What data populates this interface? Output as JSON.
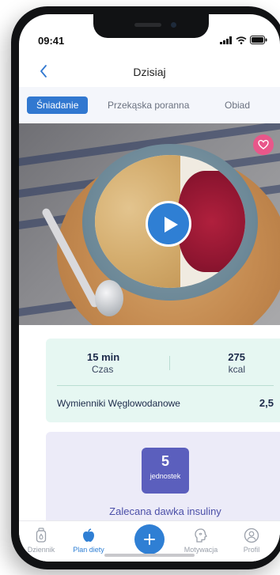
{
  "status": {
    "time": "09:41"
  },
  "nav": {
    "title": "Dzisiaj"
  },
  "tabs": [
    {
      "label": "Śniadanie"
    },
    {
      "label": "Przekąska poranna"
    },
    {
      "label": "Obiad"
    }
  ],
  "info": {
    "time_value": "15 min",
    "time_label": "Czas",
    "kcal_value": "275",
    "kcal_label": "kcal",
    "exchange_label": "Wymienniki Węglowodanowe",
    "exchange_value": "2,5"
  },
  "insulin": {
    "dose_value": "5",
    "dose_unit": "jednostek",
    "label": "Zalecana dawka insuliny"
  },
  "tabbar": [
    {
      "label": "Dziennik",
      "icon": "drop-icon"
    },
    {
      "label": "Plan diety",
      "icon": "apple-icon"
    },
    {
      "label": "",
      "icon": "plus-icon"
    },
    {
      "label": "Motywacja",
      "icon": "head-icon"
    },
    {
      "label": "Profil",
      "icon": "user-icon"
    }
  ],
  "colors": {
    "accent": "#2f7fd4",
    "info_bg": "#e6f7f2",
    "insulin_bg": "#ecebf8",
    "dose_badge": "#5b5fbd",
    "favorite": "#e8578a"
  }
}
